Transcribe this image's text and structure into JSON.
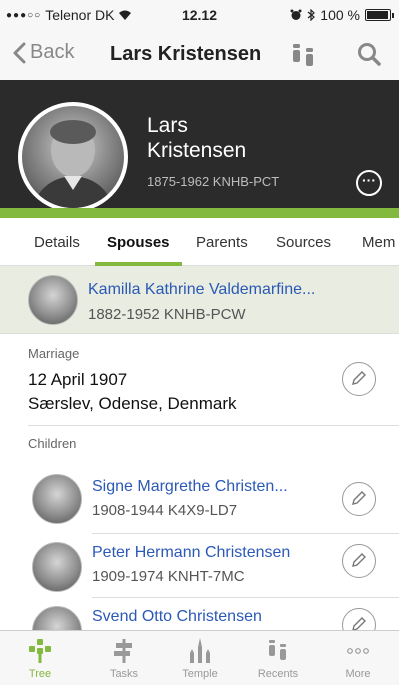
{
  "status_bar": {
    "carrier": "Telenor DK",
    "time": "12.12",
    "battery": "100 %",
    "battery_level": 1.0
  },
  "nav": {
    "back_label": "Back",
    "title": "Lars Kristensen"
  },
  "person": {
    "first_name": "Lars",
    "last_name": "Kristensen",
    "meta": "1875-1962  KNHB-PCT"
  },
  "tabs": [
    "Details",
    "Spouses",
    "Parents",
    "Sources",
    "Mem"
  ],
  "active_tab": "Spouses",
  "spouse": {
    "name": "Kamilla Kathrine Valdemarfine...",
    "meta": "1882-1952   KNHB-PCW"
  },
  "marriage": {
    "label": "Marriage",
    "date": "12 April 1907",
    "place": "Særslev, Odense, Denmark"
  },
  "children": {
    "label": "Children",
    "items": [
      {
        "name": "Signe Margrethe Christen...",
        "meta": "1908-1944   K4X9-LD7"
      },
      {
        "name": "Peter Hermann Christensen",
        "meta": "1909-1974   KNHT-7MC"
      },
      {
        "name": "Svend Otto Christensen",
        "meta": ""
      }
    ]
  },
  "tab_bar": {
    "items": [
      "Tree",
      "Tasks",
      "Temple",
      "Recents",
      "More"
    ],
    "active": "Tree",
    "accent": "#84b93f"
  },
  "colors": {
    "accent": "#84b93f",
    "link": "#2b59b6",
    "header_bg": "#2b2b2b"
  }
}
